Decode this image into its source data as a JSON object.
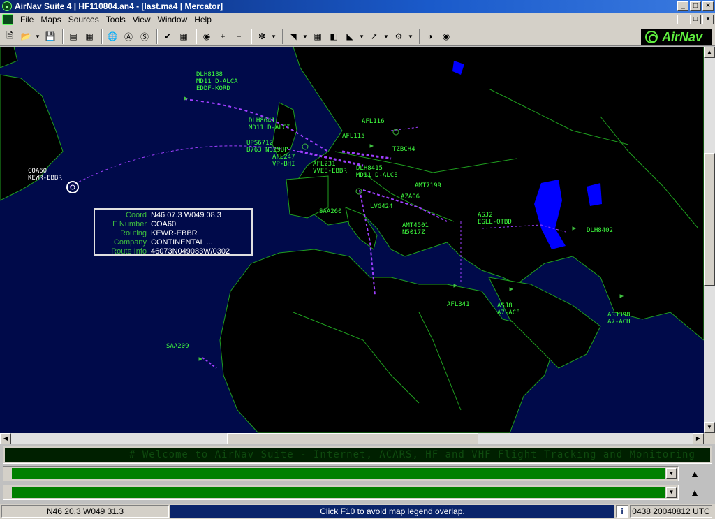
{
  "window": {
    "title": "AirNav Suite 4 | HF110804.an4 - [last.ma4 | Mercator]",
    "min_label": "_",
    "max_label": "□",
    "close_label": "×"
  },
  "menu": [
    {
      "label": "File"
    },
    {
      "label": "Maps"
    },
    {
      "label": "Sources"
    },
    {
      "label": "Tools"
    },
    {
      "label": "View"
    },
    {
      "label": "Window"
    },
    {
      "label": "Help"
    }
  ],
  "logo": {
    "text": "AirNav",
    "color": "#5fef3f"
  },
  "map": {
    "background": "#000a4a",
    "land": "#000000",
    "border_color": "#1f9f1f",
    "water_color": "#0000ff",
    "route_color": "#9f3fff",
    "flights": [
      {
        "callsign": "DLH8188",
        "lines": [
          "DLH8188",
          "MD11 D-ALCA",
          "EDDF-KORD"
        ]
      },
      {
        "callsign": "DLH8641",
        "lines": [
          "DLH8641",
          "MD11 D-ALCI"
        ]
      },
      {
        "callsign": "UPS6712",
        "lines": [
          "UPS6712",
          "B763 N329UP"
        ]
      },
      {
        "callsign": "AFL247",
        "lines": [
          "AFL247",
          "VP-BHI"
        ]
      },
      {
        "callsign": "AFL231",
        "lines": [
          "AFL231",
          "VVEE-EBBR"
        ]
      },
      {
        "callsign": "DLH8415",
        "lines": [
          "DLH8415",
          "MD11 D-ALCE"
        ]
      },
      {
        "callsign": "AFL116",
        "lines": [
          "AFL116"
        ]
      },
      {
        "callsign": "AFL115",
        "lines": [
          "AFL115"
        ]
      },
      {
        "callsign": "TZBCH4",
        "lines": [
          "TZBCH4"
        ]
      },
      {
        "callsign": "AMT7199",
        "lines": [
          "AMT7199"
        ]
      },
      {
        "callsign": "AZA06",
        "lines": [
          "AZA06"
        ]
      },
      {
        "callsign": "SAA260",
        "lines": [
          "SAA260"
        ]
      },
      {
        "callsign": "LVG424",
        "lines": [
          "LVG424"
        ]
      },
      {
        "callsign": "AMT4501",
        "lines": [
          "AMT4501",
          "N5017Z"
        ]
      },
      {
        "callsign": "ASJ2",
        "lines": [
          "ASJ2",
          "EGLL-OTBD"
        ]
      },
      {
        "callsign": "DLH8402",
        "lines": [
          "DLH8402"
        ]
      },
      {
        "callsign": "AFL341",
        "lines": [
          "AFL341"
        ]
      },
      {
        "callsign": "ASJ8",
        "lines": [
          "ASJ8",
          "A7-ACE"
        ]
      },
      {
        "callsign": "ASJ398",
        "lines": [
          "ASJ398",
          "A7-ACH"
        ]
      },
      {
        "callsign": "SAA209",
        "lines": [
          "SAA209"
        ]
      },
      {
        "callsign": "COA60",
        "lines": [
          "COA60",
          "KEWR-EBBR"
        ]
      }
    ],
    "info": {
      "rows": [
        {
          "key": "Coord",
          "value": "N46 07.3 W049 08.3"
        },
        {
          "key": "F Number",
          "value": "COA60"
        },
        {
          "key": "Routing",
          "value": "KEWR-EBBR"
        },
        {
          "key": "Company",
          "value": "CONTINENTAL ..."
        },
        {
          "key": "Route Info",
          "value": "46073N049083W/0302"
        }
      ]
    }
  },
  "ticker": {
    "text": "# Welcome to AirNav Suite - Internet, ACARS, HF and VHF Flight Tracking and Monitoring",
    "color": "#0e4a0e"
  },
  "panels": {
    "combo_color": "#008000"
  },
  "status": {
    "coord": "N46 20.3 W049 31.3",
    "message": "Click F10 to avoid map legend overlap.",
    "time": "0438 20040812 UTC"
  }
}
